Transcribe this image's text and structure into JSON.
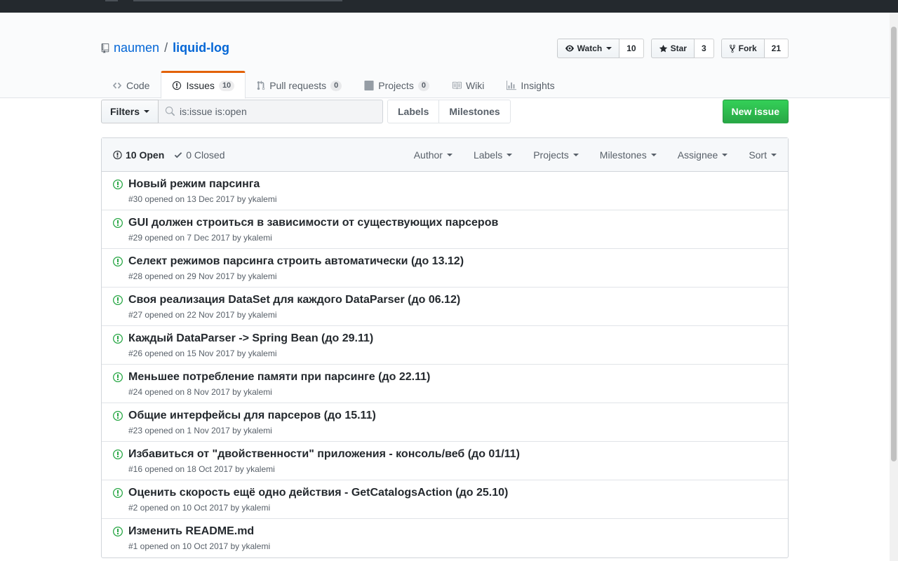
{
  "repo": {
    "owner": "naumen",
    "separator": "/",
    "name": "liquid-log"
  },
  "actions": {
    "watch": {
      "label": "Watch",
      "count": "10"
    },
    "star": {
      "label": "Star",
      "count": "3"
    },
    "fork": {
      "label": "Fork",
      "count": "21"
    }
  },
  "nav": {
    "code": {
      "label": "Code"
    },
    "issues": {
      "label": "Issues",
      "count": "10"
    },
    "pulls": {
      "label": "Pull requests",
      "count": "0"
    },
    "projects": {
      "label": "Projects",
      "count": "0"
    },
    "wiki": {
      "label": "Wiki"
    },
    "insights": {
      "label": "Insights"
    }
  },
  "subnav": {
    "filters_label": "Filters",
    "search_value": "is:issue is:open",
    "labels_link": "Labels",
    "milestones_link": "Milestones",
    "new_issue": "New issue"
  },
  "list_header": {
    "open": "10 Open",
    "closed": "0 Closed",
    "filters": {
      "author": "Author",
      "labels": "Labels",
      "projects": "Projects",
      "milestones": "Milestones",
      "assignee": "Assignee",
      "sort": "Sort"
    }
  },
  "colors": {
    "open_icon": "#28a745",
    "link": "#0366d6",
    "selected_tab": "#e36209"
  },
  "issues": [
    {
      "title": "Новый режим парсинга",
      "meta": "#30 opened on 13 Dec 2017 by ykalemi"
    },
    {
      "title": "GUI должен строиться в зависимости от существующих парсеров",
      "meta": "#29 opened on 7 Dec 2017 by ykalemi"
    },
    {
      "title": "Селект режимов парсинга строить автоматически (до 13.12)",
      "meta": "#28 opened on 29 Nov 2017 by ykalemi"
    },
    {
      "title": "Своя реализация DataSet для каждого DataParser (до 06.12)",
      "meta": "#27 opened on 22 Nov 2017 by ykalemi"
    },
    {
      "title": "Каждый DataParser -> Spring Bean (до 29.11)",
      "meta": "#26 opened on 15 Nov 2017 by ykalemi"
    },
    {
      "title": "Меньшее потребление памяти при парсинге (до 22.11)",
      "meta": "#24 opened on 8 Nov 2017 by ykalemi"
    },
    {
      "title": "Общие интерфейсы для парсеров (до 15.11)",
      "meta": "#23 opened on 1 Nov 2017 by ykalemi"
    },
    {
      "title": "Избавиться от \"двойственности\" приложения - консоль/веб (до 01/11)",
      "meta": "#16 opened on 18 Oct 2017 by ykalemi"
    },
    {
      "title": "Оценить скорость ещё одно действия - GetCatalogsAction (до 25.10)",
      "meta": "#2 opened on 10 Oct 2017 by ykalemi"
    },
    {
      "title": "Изменить README.md",
      "meta": "#1 opened on 10 Oct 2017 by ykalemi"
    }
  ]
}
